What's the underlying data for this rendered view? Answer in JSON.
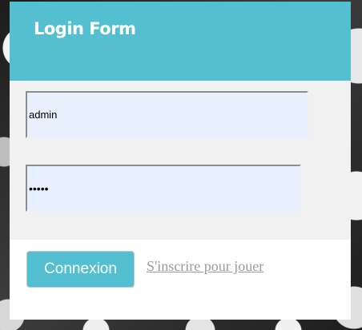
{
  "form": {
    "title": "Login Form",
    "username": {
      "value": "admin"
    },
    "password": {
      "value": "admin"
    },
    "connect_label": "Connexion",
    "register_label": "S'inscrire pour jouer"
  },
  "colors": {
    "accent": "#54bfd1",
    "field_background": "#e8f0fe",
    "fields_area": "#f1f1f1",
    "link": "#9a9a9a"
  }
}
